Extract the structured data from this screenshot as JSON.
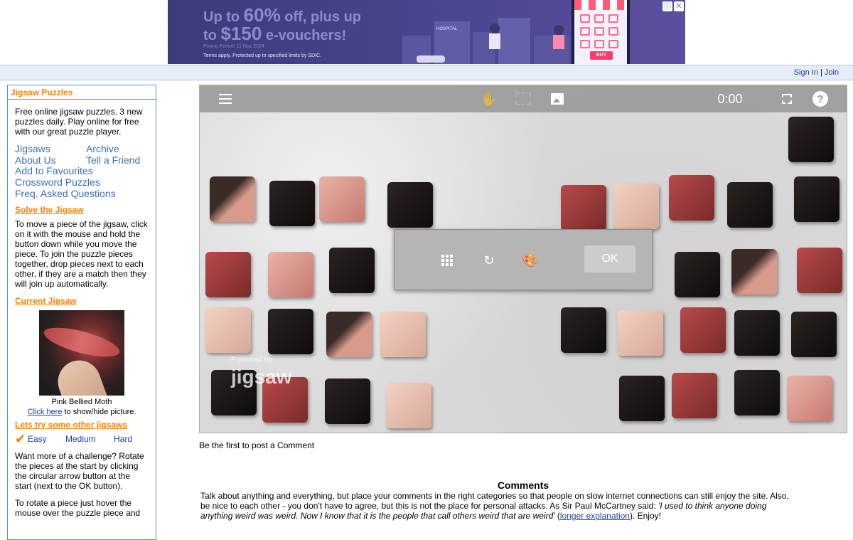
{
  "ad": {
    "line1_pre": "Up to ",
    "line1_num": "60%",
    "line1_post": " off, plus up",
    "line2_pre": "to ",
    "line2_num": "$150",
    "line2_post": " e-vouchers!",
    "promo_period": "Promo Period: 11 Nov 2024",
    "terms": "Terms apply. Protected up to specified limits by SDIC.",
    "hospital": "HOSPITAL",
    "buy": "BUY",
    "info_icon": "ⓘ",
    "close_icon": "✕"
  },
  "topbar": {
    "sign_in": "Sign In",
    "separator": "|",
    "join": "Join"
  },
  "sidebar": {
    "header": "Jigsaw Puzzles",
    "intro": "Free online jigsaw puzzles. 3 new puzzles daily. Play online for free with our great puzzle player.",
    "nav_grid": [
      "Jigsaws",
      "Archive",
      "About Us",
      "Tell a Friend"
    ],
    "nav_list": [
      "Add to Favourites",
      "Crossword Puzzles",
      "Freq. Asked Questions"
    ],
    "solve_heading": "Solve the Jigsaw",
    "solve_text": "To move a piece of the jigsaw, click on it with the mouse and hold the button down while you move the piece. To join the puzzle pieces together, drop pieces next to each other, if they are a match then they will join up automatically.",
    "current_heading": "Current Jigsaw",
    "current_name": "Pink Bellied Moth",
    "click_here": "Click here",
    "show_hide": " to show/hide picture.",
    "other_heading": "Lets try some other jigsaws",
    "levels": [
      "Easy",
      "Medium",
      "Hard"
    ],
    "challenge_text": "Want more of a challenge? Rotate the pieces at the start by clicking the circular arrow button at the start (next to the OK button).",
    "rotate_text": "To rotate a piece just hover the mouse over the puzzle piece and"
  },
  "puzzle": {
    "timer": "0:00",
    "help": "?",
    "ok": "OK",
    "watermark_top": "Powered by",
    "watermark_logo": "jigsaw"
  },
  "comments": {
    "first": "Be the first to post a Comment",
    "title": "Comments",
    "text_1": "Talk about anything and everything, but place your comments in the right categories so that people on slow internet connections can still enjoy the site. Also, be nice to each other - you don't have to agree, but this is not the place for personal attacks. As Sir Paul McCartney said: ",
    "quote": "'I used to think anyone doing anything weird was weird. Now I know that it is the people that call others weird that are weird'",
    "text_2": " (",
    "link": "longer explanation",
    "text_3": "). Enjoy!"
  }
}
